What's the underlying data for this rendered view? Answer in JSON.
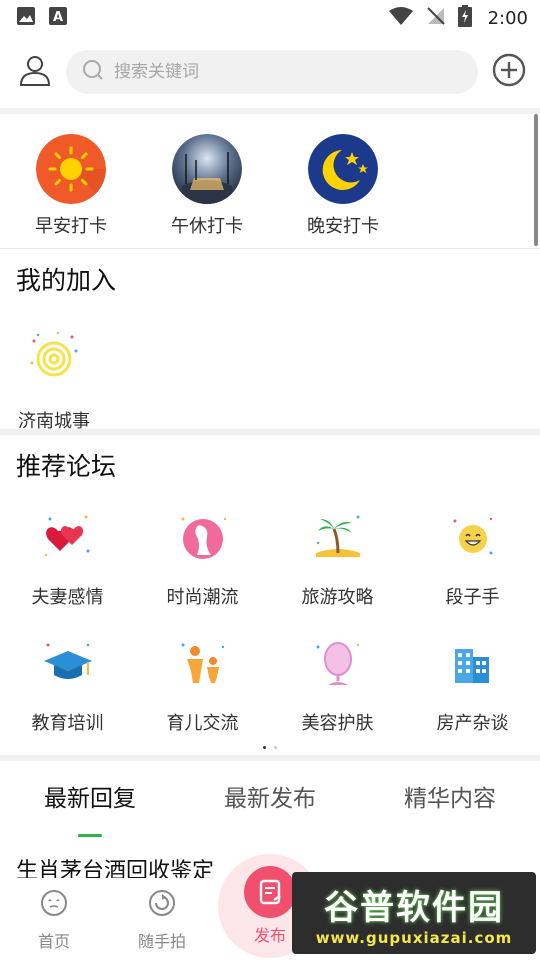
{
  "status_bar": {
    "time": "2:00",
    "icons": [
      "image-icon",
      "a-icon",
      "wifi-icon",
      "no-signal-icon",
      "battery-charging-icon"
    ]
  },
  "header": {
    "search": {
      "placeholder": "搜索关键词"
    },
    "icons": [
      "user-icon",
      "search-icon",
      "add-circle-icon"
    ]
  },
  "checkins": [
    {
      "label": "早安打卡",
      "icon": "sun-icon"
    },
    {
      "label": "午休打卡",
      "icon": "night-street-photo"
    },
    {
      "label": "晚安打卡",
      "icon": "moon-stars-icon"
    }
  ],
  "joined": {
    "title": "我的加入",
    "items": [
      {
        "label": "济南城事",
        "icon": "spiral-icon"
      }
    ]
  },
  "forums": {
    "title": "推荐论坛",
    "items": [
      {
        "label": "夫妻感情",
        "icon": "hearts-icon"
      },
      {
        "label": "时尚潮流",
        "icon": "fashion-icon"
      },
      {
        "label": "旅游攻略",
        "icon": "palm-tree-icon"
      },
      {
        "label": "段子手",
        "icon": "smiley-icon"
      },
      {
        "label": "教育培训",
        "icon": "graduation-cap-icon"
      },
      {
        "label": "育儿交流",
        "icon": "parent-child-icon"
      },
      {
        "label": "美容护肤",
        "icon": "mirror-icon"
      },
      {
        "label": "房产杂谈",
        "icon": "buildings-icon"
      }
    ],
    "page_index": 1,
    "page_count": 2
  },
  "tabs": {
    "items": [
      "最新回复",
      "最新发布",
      "精华内容"
    ],
    "active": 0
  },
  "first_post": {
    "title": "生肖茅台酒回收鉴定"
  },
  "bottom_nav": {
    "home": "首页",
    "snap": "随手拍",
    "publish": "发布"
  },
  "watermark": {
    "text": "谷普软件园",
    "url": "www.gupuxiazai.com"
  },
  "colors": {
    "accent_green": "#2fb34a",
    "publish_pink": "#f0506e"
  }
}
